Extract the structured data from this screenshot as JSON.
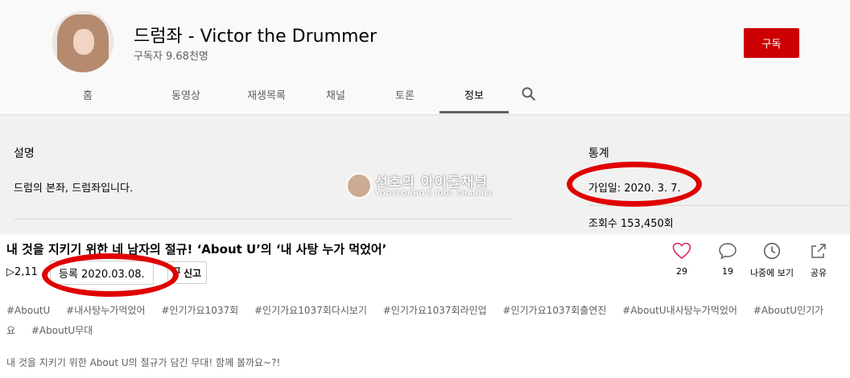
{
  "channel": {
    "name": "드럼좌 - Victor the Drummer",
    "subscribers": "구독자 9.68천명",
    "subscribe_label": "구독"
  },
  "tabs": [
    {
      "label": "홈",
      "active": false
    },
    {
      "label": "동영상",
      "active": false
    },
    {
      "label": "재생목록",
      "active": false
    },
    {
      "label": "채널",
      "active": false
    },
    {
      "label": "토론",
      "active": false
    },
    {
      "label": "정보",
      "active": true
    }
  ],
  "about": {
    "description_heading": "설명",
    "description": "드럼의 본좌, 드럼좌입니다.",
    "stats_heading": "통계",
    "joined": "가입일: 2020. 3. 7.",
    "views": "조회수 153,450회"
  },
  "watermark": {
    "main": "선호의 아이돌채널",
    "sub": "YOOSEONHO'S IDOL CHANNEL"
  },
  "video": {
    "title": "내 것을 지키기 위한 네 남자의 절규! ‘About U’의 ‘내 사탕 누가 먹었어’",
    "views": "▷2,11",
    "registered": "등록  2020.03.08.",
    "report_label": "신고",
    "actions": [
      {
        "icon": "heart-icon",
        "label": "29"
      },
      {
        "icon": "comment-icon",
        "label": "19"
      },
      {
        "icon": "clock-icon",
        "label": "나중에 보기"
      },
      {
        "icon": "share-icon",
        "label": "공유"
      }
    ],
    "hashtags": [
      "#AboutU",
      "#내사탕누가먹었어",
      "#인기가요1037회",
      "#인기가요1037회다시보기",
      "#인기가요1037회라인업",
      "#인기가요1037회출연진",
      "#AboutU내사탕누가먹었어",
      "#AboutU인기가요",
      "#AboutU무대"
    ],
    "body": "내 것을 지키기 위한 About U의 절규가 담긴 무대! 함께 볼까요~?!"
  },
  "colors": {
    "subscribe": "#cc0000",
    "annotation": "#e00000",
    "heart": "#e0245e"
  }
}
